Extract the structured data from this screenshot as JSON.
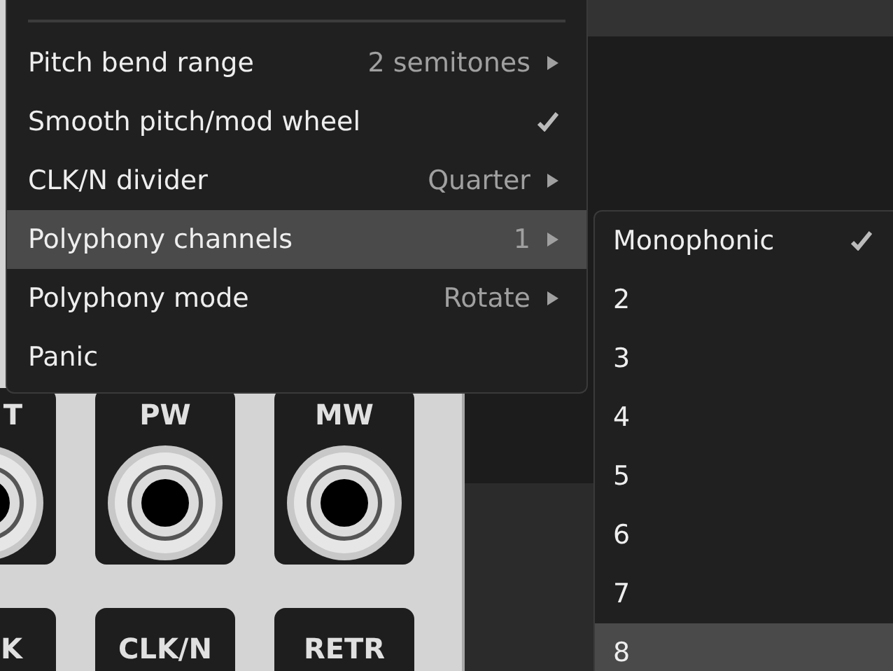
{
  "menu": {
    "items": [
      {
        "kind": "submenu",
        "label": "Pitch bend range",
        "value": "2 semitones",
        "highlighted": false
      },
      {
        "kind": "check",
        "label": "Smooth pitch/mod wheel",
        "checked": true,
        "highlighted": false
      },
      {
        "kind": "submenu",
        "label": "CLK/N divider",
        "value": "Quarter",
        "highlighted": false
      },
      {
        "kind": "submenu",
        "label": "Polyphony channels",
        "value": "1",
        "highlighted": true
      },
      {
        "kind": "submenu",
        "label": "Polyphony mode",
        "value": "Rotate",
        "highlighted": false
      },
      {
        "kind": "action",
        "label": "Panic",
        "highlighted": false
      }
    ]
  },
  "submenu": {
    "items": [
      {
        "label": "Monophonic",
        "checked": true,
        "highlighted": false
      },
      {
        "label": "2",
        "checked": false,
        "highlighted": false
      },
      {
        "label": "3",
        "checked": false,
        "highlighted": false
      },
      {
        "label": "4",
        "checked": false,
        "highlighted": false
      },
      {
        "label": "5",
        "checked": false,
        "highlighted": false
      },
      {
        "label": "6",
        "checked": false,
        "highlighted": false
      },
      {
        "label": "7",
        "checked": false,
        "highlighted": false
      },
      {
        "label": "8",
        "checked": false,
        "highlighted": true
      }
    ]
  },
  "module": {
    "ports": [
      {
        "label": "T"
      },
      {
        "label": "PW"
      },
      {
        "label": "MW"
      }
    ],
    "ports_row_2": [
      {
        "label": "K"
      },
      {
        "label": "CLK/N"
      },
      {
        "label": "RETR"
      }
    ]
  }
}
